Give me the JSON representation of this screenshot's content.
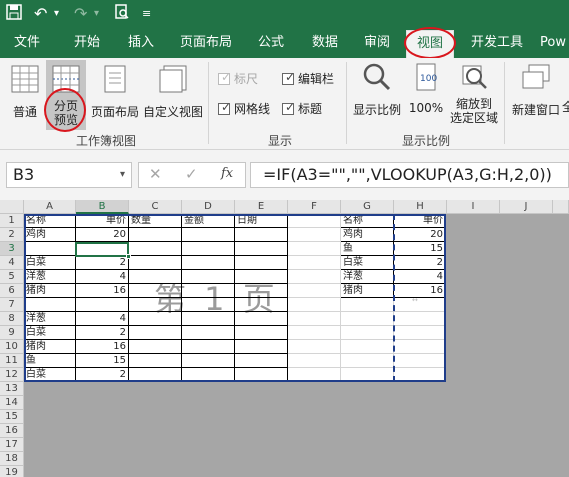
{
  "qat": {
    "save_icon": "save-icon",
    "undo_icon": "undo-icon",
    "redo_icon": "redo-icon",
    "preview_icon": "print-preview-icon",
    "more_icon": "customize-icon"
  },
  "tabs": [
    {
      "label": "文件"
    },
    {
      "label": "开始"
    },
    {
      "label": "插入"
    },
    {
      "label": "页面布局"
    },
    {
      "label": "公式"
    },
    {
      "label": "数据"
    },
    {
      "label": "审阅"
    },
    {
      "label": "视图"
    },
    {
      "label": "开发工具"
    },
    {
      "label": "Pow"
    }
  ],
  "ribbon": {
    "workbook_views": {
      "group_label": "工作簿视图",
      "normal": "普通",
      "page_break_1": "分页",
      "page_break_2": "预览",
      "page_layout": "页面布局",
      "custom_view": "自定义视图"
    },
    "show": {
      "group_label": "显示",
      "ruler": "标尺",
      "gridlines": "网格线",
      "formula_bar": "编辑栏",
      "headings": "标题",
      "ruler_checked": true,
      "gridlines_checked": true,
      "formula_bar_checked": true,
      "headings_checked": true
    },
    "zoom": {
      "group_label": "显示比例",
      "zoom": "显示比例",
      "zoom_100": "100%",
      "zoom_sel_1": "缩放到",
      "zoom_sel_2": "选定区域"
    },
    "window": {
      "new_window": "新建窗口",
      "more": "全"
    }
  },
  "formula_bar": {
    "name_box": "B3",
    "cancel": "✕",
    "enter": "✓",
    "fx": "fx",
    "formula": "=IF(A3=\"\",\"\",VLOOKUP(A3,G:H,2,0))"
  },
  "columns": [
    "A",
    "B",
    "C",
    "D",
    "E",
    "F",
    "G",
    "H",
    "I",
    "J"
  ],
  "rows": [
    "1",
    "2",
    "3",
    "4",
    "5",
    "6",
    "7",
    "8",
    "9",
    "10",
    "11",
    "12",
    "13",
    "14",
    "15",
    "16",
    "17",
    "18",
    "19"
  ],
  "sheet": {
    "A1": "名称",
    "B1": "单价",
    "C1": "数量",
    "D1": "金额",
    "E1": "日期",
    "A2": "鸡肉",
    "B2": "20",
    "A4": "白菜",
    "B4": "2",
    "A5": "洋葱",
    "B5": "4",
    "A6": "猪肉",
    "B6": "16",
    "A8": "洋葱",
    "B8": "4",
    "A9": "白菜",
    "B9": "2",
    "A10": "猪肉",
    "B10": "16",
    "A11": "鱼",
    "B11": "15",
    "A12": "白菜",
    "B12": "2",
    "G1": "名称",
    "H1": "单价",
    "G2": "鸡肉",
    "H2": "20",
    "G3": "鱼",
    "H3": "15",
    "G4": "白菜",
    "H4": "2",
    "G5": "洋葱",
    "H5": "4",
    "G6": "猪肉",
    "H6": "16"
  },
  "watermark": "第 1 页",
  "colors": {
    "excel_green": "#217346",
    "page_border": "#1f3d8a",
    "highlight": "#d9161d"
  }
}
